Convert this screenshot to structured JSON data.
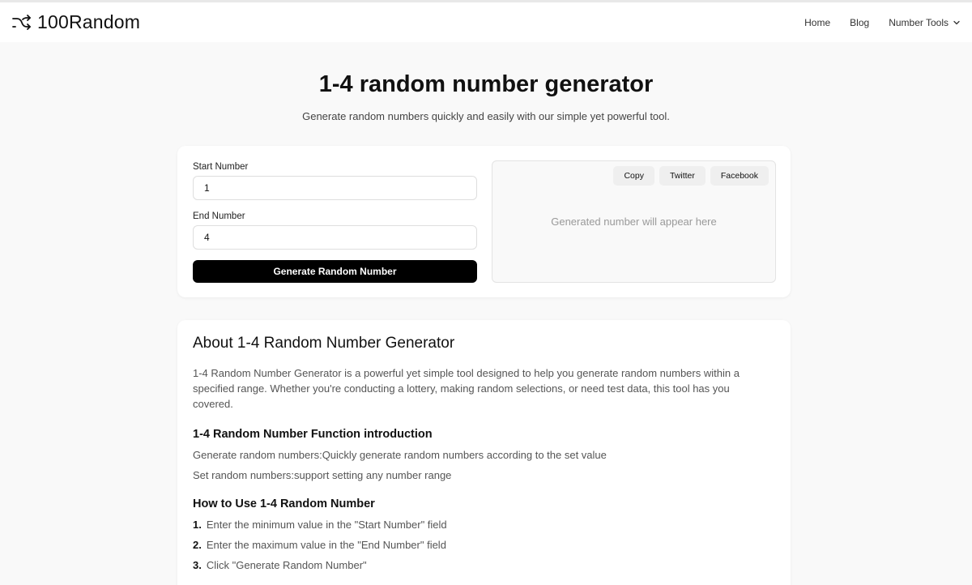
{
  "brand": {
    "name": "100Random",
    "icon": "shuffle-icon"
  },
  "nav": {
    "home": "Home",
    "blog": "Blog",
    "tools": "Number Tools"
  },
  "hero": {
    "title": "1-4 random number generator",
    "subtitle": "Generate random numbers quickly and easily with our simple yet powerful tool."
  },
  "tool": {
    "start_label": "Start Number",
    "start_value": "1",
    "end_label": "End Number",
    "end_value": "4",
    "generate_label": "Generate Random Number",
    "copy_label": "Copy",
    "twitter_label": "Twitter",
    "facebook_label": "Facebook",
    "result_placeholder": "Generated number will appear here"
  },
  "about": {
    "title": "About 1-4 Random Number Generator",
    "description": "1-4 Random Number Generator is a powerful yet simple tool designed to help you generate random numbers within a specified range. Whether you're conducting a lottery, making random selections, or need test data, this tool has you covered.",
    "functions_title": "1-4 Random Number Function introduction",
    "functions": [
      "Generate random numbers:Quickly generate random numbers according to the set value",
      "Set random numbers:support setting any number range"
    ],
    "howto_title": "How to Use 1-4 Random Number",
    "steps": [
      {
        "num": "1.",
        "text": "Enter the minimum value in the \"Start Number\" field"
      },
      {
        "num": "2.",
        "text": "Enter the maximum value in the \"End Number\" field"
      },
      {
        "num": "3.",
        "text": "Click \"Generate Random Number\""
      }
    ]
  },
  "colors": {
    "page_bg": "#f9f9f9",
    "button_bg": "#000000",
    "placeholder_text": "#999999"
  }
}
